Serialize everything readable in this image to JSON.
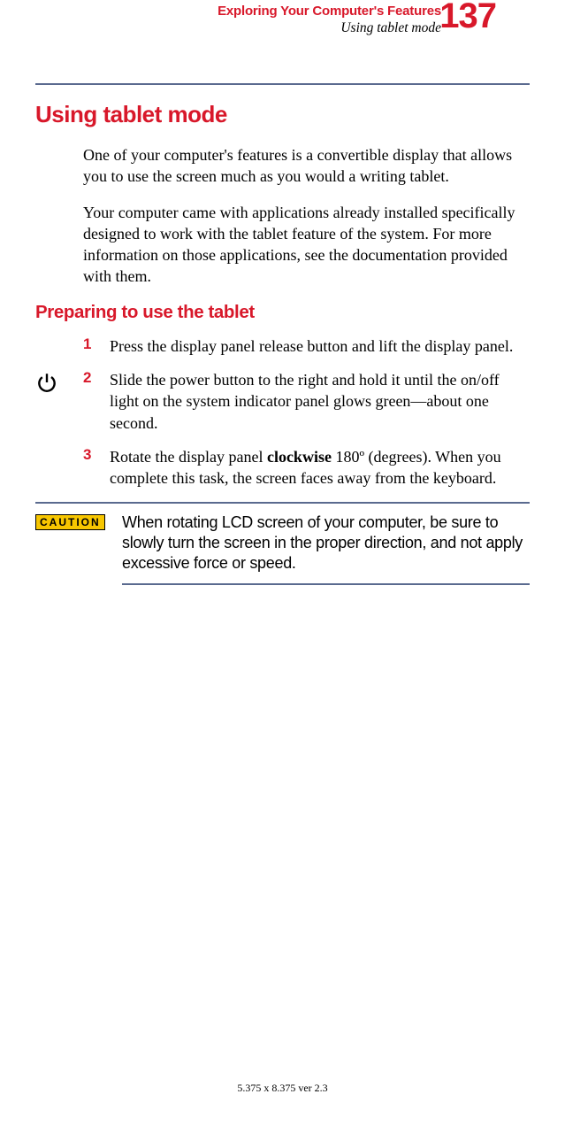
{
  "header": {
    "chapter": "Exploring Your Computer's Features",
    "section": "Using tablet mode",
    "page_number": "137"
  },
  "h1": "Using tablet mode",
  "intro_para1": "One of your computer's features is a convertible display that allows you to use the screen much as you would a writing tablet.",
  "intro_para2": "Your computer came with applications already installed specifically designed to work with the tablet feature of the system. For more information on those applications, see the documentation provided with them.",
  "h2": "Preparing to use the tablet",
  "steps": [
    {
      "num": "1",
      "text": "Press the display panel release button and lift the display panel."
    },
    {
      "num": "2",
      "text": "Slide the power button to the right and hold it until the on/off light on the system indicator panel glows green—about one second."
    },
    {
      "num": "3",
      "text_pre": "Rotate the display panel ",
      "text_bold": "clockwise",
      "text_post": " 180º (degrees). When you complete this task, the screen faces away from the keyboard."
    }
  ],
  "caution": {
    "label": "CAUTION",
    "text": " When rotating LCD screen of your computer, be sure to slowly turn the screen in the proper direction, and not apply excessive force or speed."
  },
  "footer": "5.375 x 8.375 ver 2.3"
}
